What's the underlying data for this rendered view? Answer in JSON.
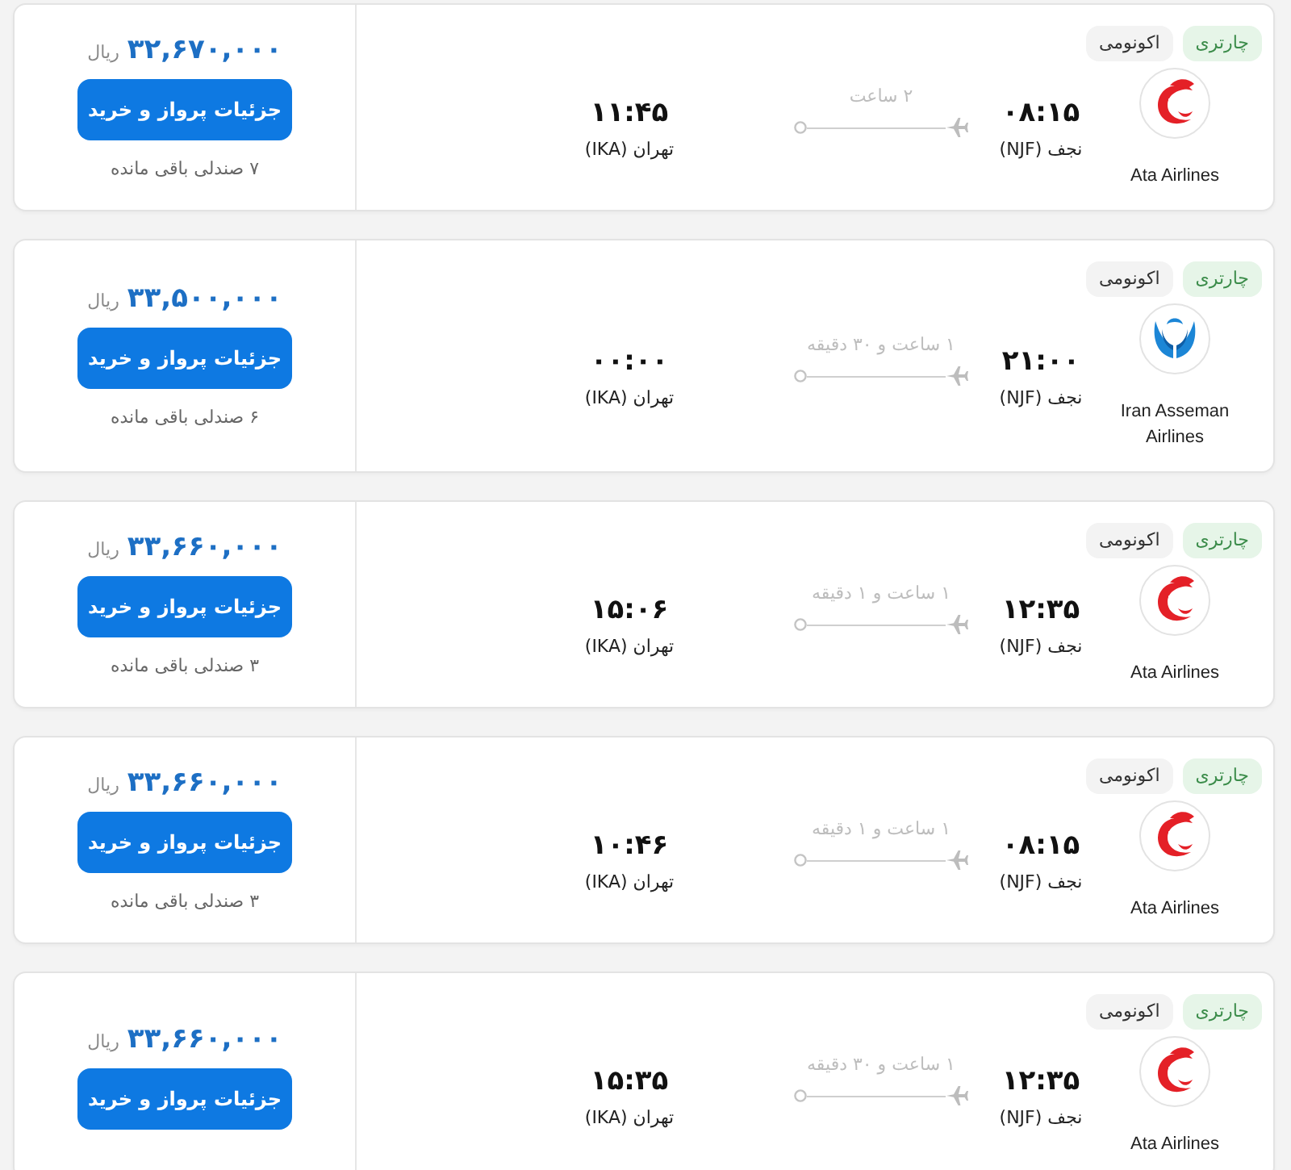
{
  "flights": [
    {
      "tags": [
        {
          "label": "چارتری",
          "kind": "fare"
        },
        {
          "label": "اکونومی",
          "kind": "cabin"
        }
      ],
      "logo": {
        "kind": "bird"
      },
      "airline": "Ata Airlines",
      "departure": {
        "time": "۰۸:۱۵",
        "airport": "نجف (NJF)"
      },
      "duration": "۲ ساعت",
      "arrival": {
        "time": "۱۱:۴۵",
        "airport": "تهران (IKA)"
      },
      "price": {
        "amount": "۳۲,۶۷۰,۰۰۰",
        "currency": "ریال"
      },
      "button": "جزئیات پرواز و خرید",
      "seats": "۷ صندلی باقی مانده"
    },
    {
      "tags": [
        {
          "label": "چارتری",
          "kind": "fare"
        },
        {
          "label": "اکونومی",
          "kind": "cabin"
        }
      ],
      "logo": {
        "kind": "wings"
      },
      "airline": "Iran Asseman Airlines",
      "departure": {
        "time": "۲۱:۰۰",
        "airport": "نجف (NJF)"
      },
      "duration": "۱ ساعت و ۳۰ دقیقه",
      "arrival": {
        "time": "۰۰:۰۰",
        "airport": "تهران (IKA)"
      },
      "price": {
        "amount": "۳۳,۵۰۰,۰۰۰",
        "currency": "ریال"
      },
      "button": "جزئیات پرواز و خرید",
      "seats": "۶ صندلی باقی مانده"
    },
    {
      "tags": [
        {
          "label": "چارتری",
          "kind": "fare"
        },
        {
          "label": "اکونومی",
          "kind": "cabin"
        }
      ],
      "logo": {
        "kind": "bird"
      },
      "airline": "Ata Airlines",
      "departure": {
        "time": "۱۲:۳۵",
        "airport": "نجف (NJF)"
      },
      "duration": "۱ ساعت و ۱ دقیقه",
      "arrival": {
        "time": "۱۵:۰۶",
        "airport": "تهران (IKA)"
      },
      "price": {
        "amount": "۳۳,۶۶۰,۰۰۰",
        "currency": "ریال"
      },
      "button": "جزئیات پرواز و خرید",
      "seats": "۳ صندلی باقی مانده"
    },
    {
      "tags": [
        {
          "label": "چارتری",
          "kind": "fare"
        },
        {
          "label": "اکونومی",
          "kind": "cabin"
        }
      ],
      "logo": {
        "kind": "bird"
      },
      "airline": "Ata Airlines",
      "departure": {
        "time": "۰۸:۱۵",
        "airport": "نجف (NJF)"
      },
      "duration": "۱ ساعت و ۱ دقیقه",
      "arrival": {
        "time": "۱۰:۴۶",
        "airport": "تهران (IKA)"
      },
      "price": {
        "amount": "۳۳,۶۶۰,۰۰۰",
        "currency": "ریال"
      },
      "button": "جزئیات پرواز و خرید",
      "seats": "۳ صندلی باقی مانده"
    },
    {
      "tags": [
        {
          "label": "چارتری",
          "kind": "fare"
        },
        {
          "label": "اکونومی",
          "kind": "cabin"
        }
      ],
      "logo": {
        "kind": "bird"
      },
      "airline": "Ata Airlines",
      "departure": {
        "time": "۱۲:۳۵",
        "airport": "نجف (NJF)"
      },
      "duration": "۱ ساعت و ۳۰ دقیقه",
      "arrival": {
        "time": "۱۵:۳۵",
        "airport": "تهران (IKA)"
      },
      "price": {
        "amount": "۳۳,۶۶۰,۰۰۰",
        "currency": "ریال"
      },
      "button": "جزئیات پرواز و خرید"
    }
  ]
}
